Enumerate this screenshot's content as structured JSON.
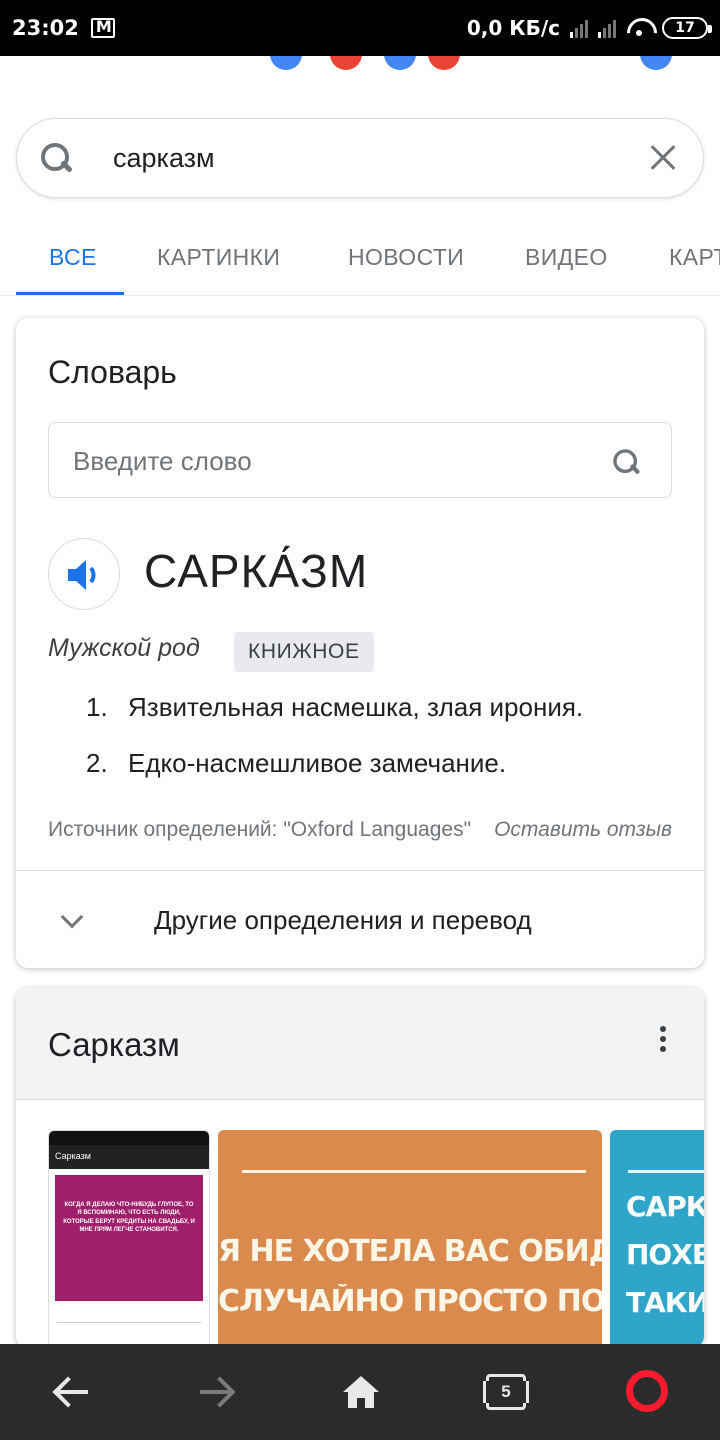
{
  "status_bar": {
    "time": "23:02",
    "net_speed": "0,0 КБ/с",
    "battery": "17"
  },
  "search": {
    "query": "сарказм"
  },
  "tabs": [
    {
      "label": "ВСЕ",
      "active": true
    },
    {
      "label": "КАРТИНКИ",
      "active": false
    },
    {
      "label": "НОВОСТИ",
      "active": false
    },
    {
      "label": "ВИДЕО",
      "active": false
    },
    {
      "label": "КАРТЫ",
      "active": false
    }
  ],
  "dictionary": {
    "title": "Словарь",
    "input_placeholder": "Введите слово",
    "headword": "САРКА́ЗМ",
    "part_of_speech": "Мужской род",
    "register": "КНИЖНОЕ",
    "definitions": [
      {
        "num": "1.",
        "text": "Язвительная насмешка, злая ирония."
      },
      {
        "num": "2.",
        "text": "Едко-насмешливое замечание."
      }
    ],
    "source": "Источник определений: \"Oxford Languages\"",
    "feedback": "Оставить отзыв",
    "more": "Другие определения и перевод"
  },
  "images": {
    "title": "Сарказм",
    "thumb1": {
      "header": "Сарказм",
      "text": "КОГДА Я ДЕЛАЮ ЧТО-НИБУДЬ ГЛУПОЕ, ТО Я ВСПОМИНАЮ, ЧТО ЕСТЬ ЛЮДИ, КОТОРЫЕ БЕРУТ КРЕДИТЫ НА СВАДЬБУ, И МНЕ ПРЯМ ЛЕГЧЕ СТАНОВИТСЯ."
    },
    "thumb2": {
      "line1": "Я НЕ ХОТЕЛА ВАС ОБИДЕТЬ,",
      "line2": "СЛУЧАЙНО ПРОСТО ПОВЕЗЛО"
    },
    "thumb3": {
      "line1": "САРКАЗ",
      "line2": "ПОХВ",
      "line3": "ТАКИМ"
    }
  },
  "bottom_nav": {
    "tab_count": "5"
  },
  "colors": {
    "accent": "#1a73e8",
    "text": "#202124",
    "muted": "#70757a",
    "opera_red": "#ff1b2d"
  }
}
